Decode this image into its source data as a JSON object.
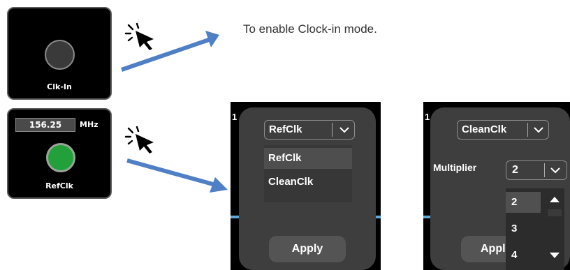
{
  "clockin": {
    "label": "Clk-In",
    "caption": "To enable Clock-in mode."
  },
  "refclk_tile": {
    "frequency": "156.25",
    "unit": "MHz",
    "label": "RefClk",
    "led_color": "#22a03a"
  },
  "panel_refclk": {
    "edge_digit": "1",
    "selected": "RefClk",
    "options": [
      "RefClk",
      "CleanClk"
    ],
    "apply_label": "Apply"
  },
  "panel_cleanclk": {
    "edge_digit": "1",
    "selected": "CleanClk",
    "multiplier_label": "Multiplier",
    "multiplier_value": "2",
    "multiplier_options": [
      "2",
      "3",
      "4"
    ],
    "apply_label": "Appl"
  },
  "colors": {
    "arrow": "#4f7fc4",
    "led_off": "#3a3a3a",
    "panel_card": "#3e3e3e"
  }
}
